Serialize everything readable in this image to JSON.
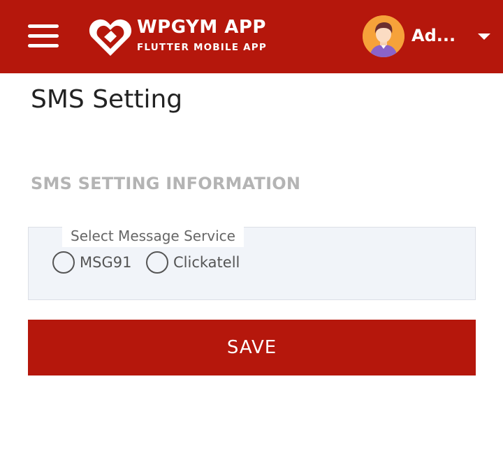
{
  "header": {
    "brand_title": "WPGYM APP",
    "brand_subtitle": "FLUTTER MOBILE APP",
    "user_name": "Ad...",
    "menu_icon": "hamburger-menu-icon",
    "dropdown_icon": "caret-down-icon",
    "background_color": "#b5170c"
  },
  "page": {
    "title": "SMS Setting",
    "section_title": "SMS SETTING INFORMATION"
  },
  "message_service": {
    "legend": "Select Message Service",
    "options": [
      {
        "label": "MSG91",
        "selected": false
      },
      {
        "label": "Clickatell",
        "selected": false
      }
    ]
  },
  "actions": {
    "save_label": "SAVE",
    "accent_color": "#b5170c"
  }
}
